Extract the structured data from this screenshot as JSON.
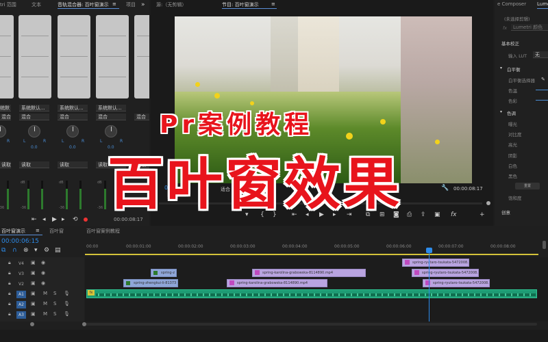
{
  "tabs": {
    "left_partial": "tri 范围",
    "text": "文本",
    "mixer": "音轨混合器: 百叶窗演示",
    "mixer_menu": "≡",
    "project": "项目",
    "source": "源:（无剪辑）",
    "program": "节目: 百叶窗演示",
    "program_menu": "≡",
    "composer": "e Composer",
    "lumetri": "Lume"
  },
  "mixer": {
    "channels": [
      {
        "read": "系统默认...",
        "mode": "混合",
        "val": "",
        "auto": "读取"
      },
      {
        "read": "系统默认...",
        "mode": "混合",
        "val": "0.0",
        "auto": "读取"
      },
      {
        "read": "系统默认...",
        "mode": "混合",
        "val": "0.0",
        "auto": "读取"
      },
      {
        "read": "系统默认...",
        "mode": "混合",
        "val": "0.0",
        "auto": "读取"
      },
      {
        "read": "",
        "mode": "混合",
        "val": "",
        "auto": "读取"
      }
    ],
    "lr_l": "L",
    "lr_r": "R",
    "db_labels": [
      "dB",
      "-",
      "-",
      "-36"
    ],
    "timecode": "00:00:08:17"
  },
  "program": {
    "timecode_left": "00",
    "fit": "适合",
    "timecode_right": "00:00:08:17"
  },
  "overlay": {
    "line1": "Pr案例教程",
    "line2": "百叶窗效果"
  },
  "lumetri": {
    "selection": "(未选择剪辑)",
    "fx_label": "fx",
    "effect": "Lumetri 颜色",
    "sections": [
      {
        "label": "基本校正",
        "head": true
      },
      {
        "label": "输入 LUT",
        "head": false
      },
      {
        "label": "白平衡",
        "head": true
      },
      {
        "label": "白平衡选择器",
        "head": false
      },
      {
        "label": "色温",
        "head": false
      },
      {
        "label": "色彩",
        "head": false
      },
      {
        "label": "色调",
        "head": true
      },
      {
        "label": "曝光",
        "head": false
      },
      {
        "label": "对比度",
        "head": false
      },
      {
        "label": "高光",
        "head": false
      },
      {
        "label": "阴影",
        "head": false
      },
      {
        "label": "白色",
        "head": false
      },
      {
        "label": "黑色",
        "head": false
      },
      {
        "label": "饱和度",
        "head": false
      },
      {
        "label": "创意",
        "head": true
      }
    ],
    "lut_value": "无",
    "reset": "重置"
  },
  "timeline": {
    "tabs": [
      "百叶窗演示",
      "百叶窗",
      "百叶窗案例教程"
    ],
    "tab_menu": "≡",
    "timecode": "00:00:06:15",
    "ruler": [
      "00:00",
      "00:00:01:00",
      "00:00:02:00",
      "00:00:03:00",
      "00:00:04:00",
      "00:00:05:00",
      "00:00:06:00",
      "00:00:07:00",
      "00:00:08:00"
    ],
    "video_tracks": [
      "V4",
      "V3",
      "V2"
    ],
    "audio_tracks": [
      "A1",
      "A2",
      "A3"
    ],
    "track_m": "M",
    "track_s": "S",
    "clips": {
      "v4_c1": "spring-ryutaro-tsukata-5472008.",
      "v3_c1": "spring-z",
      "v3_c2": "spring-karolina-grabowska-8114890.mp4",
      "v3_c3": "spring-ryutaro-tsukata-5472008.",
      "v2_c1": "spring-zhengkui-li-81373",
      "v2_c2": "spring-karolina-grabowska-8114890.mp4",
      "v2_c3": "spring-ryutaro-tsukata-5472008.",
      "v1_fx": "fx"
    },
    "playhead_fraction": 0.79
  },
  "colors": {
    "accent_blue": "#2d8ceb",
    "overlay_red": "#e8141c",
    "audio_green": "#1e9b74",
    "clip_blue": "#8fa6d8",
    "clip_purple": "#b9a4e0"
  }
}
